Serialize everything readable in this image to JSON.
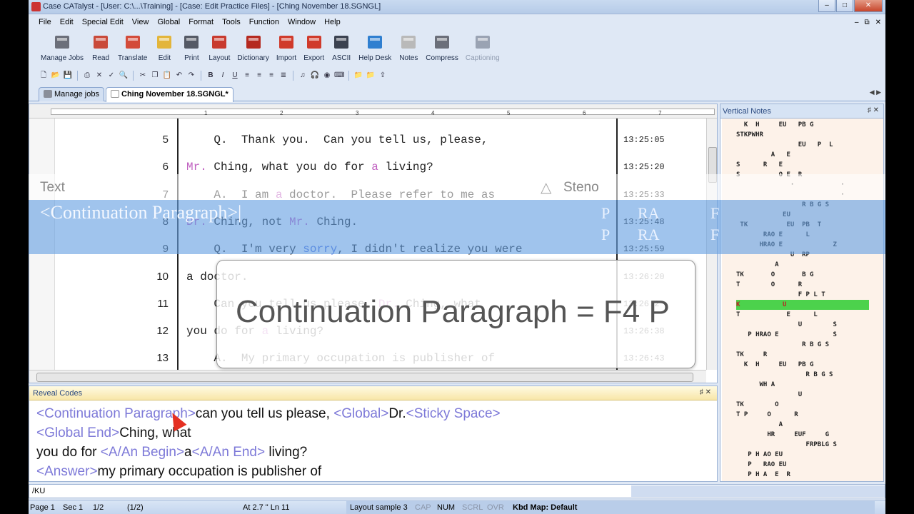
{
  "window": {
    "title": "Case CATalyst - [User: C:\\...\\Training] - [Case: Edit Practice Files] - [Ching November 18.SGNGL]",
    "buttons": [
      "–",
      "□",
      "✕"
    ]
  },
  "menu": {
    "items": [
      "File",
      "Edit",
      "Special Edit",
      "View",
      "Global",
      "Format",
      "Tools",
      "Function",
      "Window",
      "Help"
    ],
    "mdi": [
      "–",
      "⧉",
      "✕"
    ]
  },
  "ribbon": {
    "buttons": [
      {
        "label": "Manage Jobs",
        "icon": "manage-jobs-icon",
        "color": "#6b6f7a"
      },
      {
        "label": "Read",
        "icon": "read-icon",
        "color": "#c94a3a"
      },
      {
        "label": "Translate",
        "icon": "translate-icon",
        "color": "#d34b3a"
      },
      {
        "label": "Edit",
        "icon": "edit-icon",
        "color": "#e3b53a"
      },
      {
        "label": "Print",
        "icon": "print-icon",
        "color": "#555a66"
      },
      {
        "label": "Layout",
        "icon": "layout-icon",
        "color": "#c83a2e"
      },
      {
        "label": "Dictionary",
        "icon": "dictionary-icon",
        "color": "#b5291f"
      },
      {
        "label": "Import",
        "icon": "import-icon",
        "color": "#d03a2b"
      },
      {
        "label": "Export",
        "icon": "export-icon",
        "color": "#d03a2b"
      },
      {
        "label": "ASCII",
        "icon": "ascii-icon",
        "color": "#3b4250"
      },
      {
        "label": "Help Desk",
        "icon": "help-desk-icon",
        "color": "#2f7fd0"
      },
      {
        "label": "Notes",
        "icon": "notes-icon",
        "color": "#b9b9b9"
      },
      {
        "label": "Compress",
        "icon": "compress-icon",
        "color": "#6b6f7a"
      },
      {
        "label": "Captioning",
        "icon": "captioning-icon",
        "color": "#9aa3b3",
        "disabled": true
      }
    ]
  },
  "tabs": [
    {
      "label": "Manage jobs",
      "active": false
    },
    {
      "label": "Ching November 18.SGNGL*",
      "active": true
    }
  ],
  "ruler": {
    "ticks": [
      "1",
      "2",
      "3",
      "4",
      "5",
      "6",
      "7"
    ]
  },
  "editor": {
    "lines": [
      {
        "num": "5",
        "text": [
          [
            "",
            "    Q.  Thank you.  Can you tell us, please,"
          ]
        ],
        "ts": "13:25:05"
      },
      {
        "num": "6",
        "text": [
          [
            "pk",
            "Mr."
          ],
          [
            "",
            " Ching, what you do for "
          ],
          [
            "pk",
            "a"
          ],
          [
            "",
            " living?"
          ]
        ],
        "ts": "13:25:20"
      },
      {
        "num": "7",
        "text": [
          [
            "",
            "    A.  I am "
          ],
          [
            "pk",
            "a"
          ],
          [
            "",
            " doctor.  Please refer to me as"
          ]
        ],
        "ts": "13:25:33"
      },
      {
        "num": "8",
        "text": [
          [
            "pk",
            "Dr."
          ],
          [
            "",
            " Ching, not "
          ],
          [
            "pk",
            "Mr."
          ],
          [
            "",
            " Ching."
          ]
        ],
        "ts": "13:25:48"
      },
      {
        "num": "9",
        "text": [
          [
            "",
            "    Q.  I'm very "
          ],
          [
            "bl",
            "sorry"
          ],
          [
            "",
            ", I didn't realize you were"
          ]
        ],
        "ts": "13:25:59"
      },
      {
        "num": "10",
        "text": [
          [
            "",
            "a doctor."
          ]
        ],
        "ts": "13:26:20"
      },
      {
        "num": "11",
        "text": [
          [
            "",
            "    Can you tell us please, "
          ],
          [
            "pk",
            "Dr."
          ],
          [
            "",
            " Ching, what"
          ]
        ],
        "ts": "13:26:2"
      },
      {
        "num": "12",
        "text": [
          [
            "",
            "you do for "
          ],
          [
            "pk",
            "a"
          ],
          [
            "",
            " living?"
          ]
        ],
        "ts": "13:26:38"
      },
      {
        "num": "13",
        "text": [
          [
            "",
            "    A.  My primary occupation is publisher of"
          ]
        ],
        "ts": "13:26:43"
      }
    ]
  },
  "overlay": {
    "text_header": "Text",
    "steno_header": "Steno",
    "arrow": "△",
    "selection_label": "<Continuation Paragraph>|",
    "selection_steno": [
      "P",
      "RA",
      "F",
      "P",
      "RA",
      "F"
    ],
    "popup": "Continuation Paragraph = F4 P"
  },
  "vertical_notes": {
    "title": "Vertical Notes",
    "pin": "♯ ✕",
    "lines": [
      {
        "y": 0,
        "text": "  K  H     EU   PB G"
      },
      {
        "y": 1,
        "text": "STKPWHR"
      },
      {
        "y": 2,
        "text": "                EU   P  L"
      },
      {
        "y": 3,
        "text": "         A   E"
      },
      {
        "y": 4,
        "text": "S      R   E"
      },
      {
        "y": 5,
        "text": "S          O E  R"
      },
      {
        "y": 6,
        "text": "              ·            ·"
      },
      {
        "y": 7,
        "text": "                           ·"
      },
      {
        "y": 8,
        "text": "                 R B G S"
      },
      {
        "y": 9,
        "text": "            EU"
      },
      {
        "y": 10,
        "text": " TK          EU  PB  T"
      },
      {
        "y": 11,
        "text": "       RAO E      L"
      },
      {
        "y": 12,
        "text": "      HRAO E             Z"
      },
      {
        "y": 13,
        "text": "              U  RP"
      },
      {
        "y": 14,
        "text": "          A"
      },
      {
        "y": 15,
        "text": "TK       O       B G"
      },
      {
        "y": 16,
        "text": "T        O      R"
      },
      {
        "y": 17,
        "text": "                F P L T"
      },
      {
        "y": 18,
        "text": "K           U",
        "highlight": true
      },
      {
        "y": 19,
        "text": "T            E      L"
      },
      {
        "y": 20,
        "text": "                U        S"
      },
      {
        "y": 21,
        "text": "   P HRAO E              S"
      },
      {
        "y": 22,
        "text": "                 R B G S"
      },
      {
        "y": 23,
        "text": "TK     R"
      },
      {
        "y": 24,
        "text": "  K  H     EU   PB G"
      },
      {
        "y": 25,
        "text": "                  R B G S"
      },
      {
        "y": 26,
        "text": "      WH A"
      },
      {
        "y": 27,
        "text": "                U"
      },
      {
        "y": 28,
        "text": "TK        O"
      },
      {
        "y": 29,
        "text": "T P     O      R"
      },
      {
        "y": 30,
        "text": "           A"
      },
      {
        "y": 31,
        "text": "        HR     EUF     G"
      },
      {
        "y": 32,
        "text": "                  FRPBLG S"
      },
      {
        "y": 33,
        "text": "   P H AO EU"
      },
      {
        "y": 34,
        "text": "   P   RAO EU"
      },
      {
        "y": 35,
        "text": "   P H A  E  R"
      }
    ]
  },
  "reveal_codes": {
    "title": "Reveal Codes",
    "pin": "♯ ✕",
    "lines": [
      [
        [
          "code",
          "<Continuation Paragraph>"
        ],
        [
          "",
          "can you tell us please, "
        ],
        [
          "code",
          "<Global>"
        ],
        [
          "",
          "Dr."
        ],
        [
          "code",
          "<Sticky Space>"
        ]
      ],
      [
        [
          "code",
          "<Global End>"
        ],
        [
          "",
          "Ching, what"
        ]
      ],
      [
        [
          "",
          "you do for "
        ],
        [
          "code",
          "<A/An Begin>"
        ],
        [
          "",
          "a"
        ],
        [
          "code",
          "<A/An End>"
        ],
        [
          "",
          " living?"
        ]
      ],
      [
        [
          "code",
          "<Answer>"
        ],
        [
          "",
          "my primary occupation is publisher of"
        ]
      ]
    ]
  },
  "command_bar": {
    "text": "/KU"
  },
  "status": {
    "page": "Page 1",
    "sec": "Sec 1",
    "pages": "1/2",
    "pages2": "(1/2)",
    "at": "At 2.7 \" Ln 11",
    "layout": "Layout sample 3",
    "cap": "CAP",
    "num": "NUM",
    "scrl": "SCRL",
    "ovr": "OVR",
    "kbd": "Kbd Map: Default"
  },
  "colors": {
    "accent": "#66a0e2",
    "code": "#7d79d8",
    "global_word": "#c060c0",
    "spell": "#4a6ee0",
    "steno_highlight": "#4cd24c",
    "reveal_header": "#f8e6a8"
  }
}
